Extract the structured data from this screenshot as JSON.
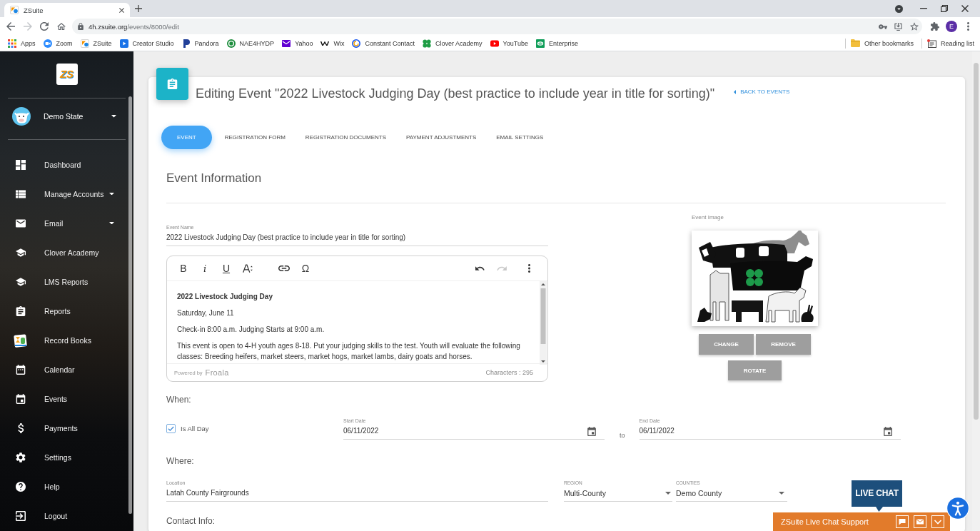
{
  "browser": {
    "tabs": [
      {
        "title": "ZSuite",
        "selected": true
      }
    ],
    "forward_disabled": true,
    "url": "4h.zsuite.org/events/8000/edit",
    "profile_initial": "E",
    "bookmarks": [
      {
        "label": "Apps"
      },
      {
        "label": "Zoom"
      },
      {
        "label": "ZSuite"
      },
      {
        "label": "Creator Studio"
      },
      {
        "label": "Pandora"
      },
      {
        "label": "NAE4HYDP"
      },
      {
        "label": "Yahoo"
      },
      {
        "label": "Wix"
      },
      {
        "label": "Constant Contact"
      },
      {
        "label": "Clover Academy"
      },
      {
        "label": "YouTube"
      },
      {
        "label": "Enterprise"
      }
    ],
    "other_bookmarks": "Other bookmarks",
    "reading_list": "Reading list"
  },
  "sidebar": {
    "logo": "ZS",
    "account": "Demo State",
    "items": [
      {
        "label": "Dashboard",
        "submenu": false
      },
      {
        "label": "Manage Accounts",
        "submenu": true
      },
      {
        "label": "Email",
        "submenu": true
      },
      {
        "label": "Clover Academy",
        "submenu": false
      },
      {
        "label": "LMS Reports",
        "submenu": false
      },
      {
        "label": "Reports",
        "submenu": false
      },
      {
        "label": "Record Books",
        "submenu": false
      },
      {
        "label": "Calendar",
        "submenu": false
      },
      {
        "label": "Events",
        "submenu": false
      },
      {
        "label": "Payments",
        "submenu": false
      },
      {
        "label": "Settings",
        "submenu": false
      },
      {
        "label": "Help",
        "submenu": false
      },
      {
        "label": "Logout",
        "submenu": false
      }
    ]
  },
  "page": {
    "title": "Editing Event \"2022 Livestock Judging Day (best practice to include year in title for sorting)\"",
    "back_link": "BACK TO EVENTS",
    "tabs": [
      {
        "label": "EVENT",
        "selected": true
      },
      {
        "label": "REGISTRATION FORM",
        "selected": false
      },
      {
        "label": "REGISTRATION DOCUMENTS",
        "selected": false
      },
      {
        "label": "PAYMENT ADJUSTMENTS",
        "selected": false
      },
      {
        "label": "EMAIL SETTINGS",
        "selected": false
      }
    ],
    "section_title": "Event Information",
    "event_name": {
      "label": "Event Name",
      "value": "2022 Livestock Judging Day (best practice to include year in title for sorting)"
    },
    "editor": {
      "toolbar": [
        {
          "kind": "bold",
          "text": "B",
          "disabled": false
        },
        {
          "kind": "italic",
          "text": "i",
          "disabled": false
        },
        {
          "kind": "underline",
          "text": "U",
          "disabled": false
        },
        {
          "kind": "font-size",
          "disabled": false
        },
        {
          "kind": "link",
          "disabled": false
        },
        {
          "kind": "special-char",
          "text": "Ω",
          "disabled": false
        },
        {
          "kind": "undo",
          "disabled": false
        },
        {
          "kind": "redo",
          "disabled": true
        },
        {
          "kind": "more",
          "disabled": false
        }
      ],
      "paragraphs": [
        {
          "text": "2022 Livestock Judging Day",
          "bold": true
        },
        {
          "text": "Saturday, June 11",
          "bold": false
        },
        {
          "text": "Check-in 8:00 a.m. Judging Starts at 9:00 a.m.",
          "bold": false
        },
        {
          "text": "This event is open to 4-H youth ages 8-18. Put your judging skills to the test. Youth will evaluate the following classes: Breeding heifers, market steers, market hogs, market lambs, dairy goats and horses.",
          "bold": false
        }
      ],
      "powered_by": "Powered by",
      "brand": "Froala",
      "character_count": "Characters : 295"
    },
    "event_image": {
      "label": "Event Image",
      "button_rows": [
        {
          "buttons": [
            "CHANGE",
            "REMOVE"
          ]
        },
        {
          "buttons": [
            "ROTATE"
          ]
        }
      ]
    },
    "when": {
      "heading": "When:",
      "all_day": {
        "label": "Is All Day",
        "checked": true
      },
      "start_date": {
        "label": "Start Date",
        "value": "06/11/2022"
      },
      "separator": "to",
      "end_date": {
        "label": "End Date",
        "value": "06/11/2022"
      }
    },
    "where": {
      "heading": "Where:",
      "location": {
        "label": "Location",
        "value": "Latah County Fairgrounds"
      },
      "region": {
        "label": "REGION",
        "value": "Multi-County"
      },
      "counties": {
        "label": "COUNTIES",
        "value": "Demo County"
      }
    },
    "contact": {
      "heading": "Contact Info:"
    }
  },
  "live_chat": {
    "badge": "LIVE CHAT",
    "title": "ZSuite Live Chat Support"
  }
}
